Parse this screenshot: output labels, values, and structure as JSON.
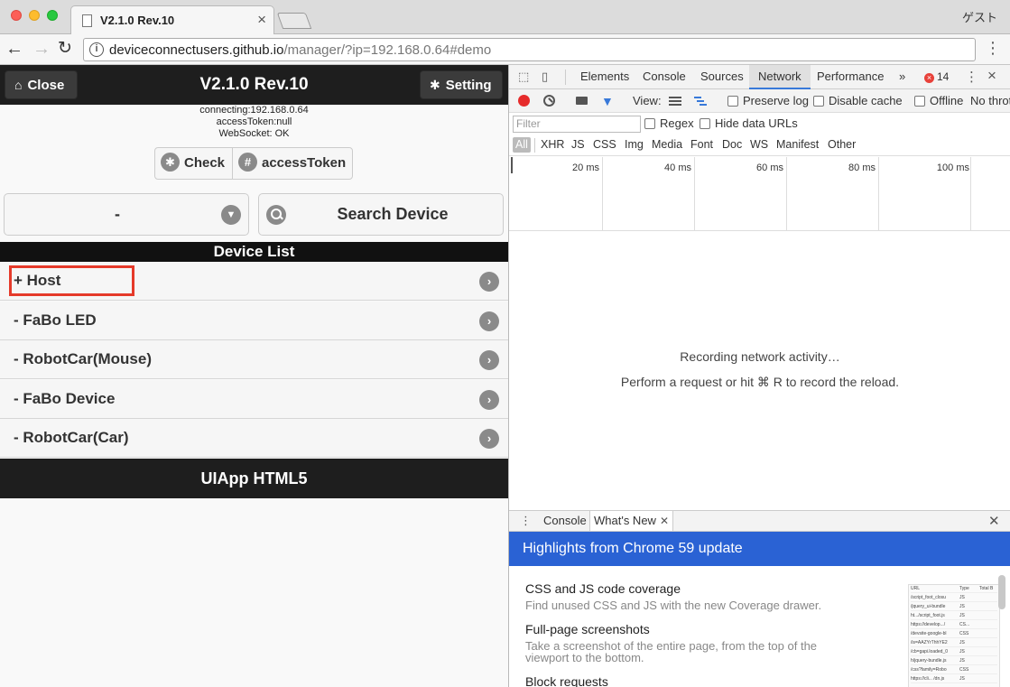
{
  "browser": {
    "tab_title": "V2.1.0 Rev.10",
    "tab_close": "×",
    "guest_label": "ゲスト",
    "url_host": "deviceconnectusers.github.io",
    "url_rest": "/manager/?ip=192.168.0.64#demo",
    "back": "←",
    "forward": "→",
    "reload": "↻",
    "info": "i",
    "menu": "⋮"
  },
  "app": {
    "close_label": "Close",
    "close_icon": "home-icon",
    "title": "V2.1.0 Rev.10",
    "setting_label": "Setting",
    "setting_icon": "gear-icon",
    "status_connecting": "connecting:192.168.0.64",
    "status_token": "accessToken:null",
    "status_ws": "WebSocket: OK",
    "check_label": "Check",
    "access_token_label": "accessToken",
    "select_value": "-",
    "search_label": "Search Device",
    "device_list_title": "Device List",
    "devices": [
      {
        "label": "+ Host"
      },
      {
        "label": "- FaBo LED"
      },
      {
        "label": "- RobotCar(Mouse)"
      },
      {
        "label": "- FaBo Device"
      },
      {
        "label": "- RobotCar(Car)"
      }
    ],
    "footer": "UIApp HTML5"
  },
  "devtools": {
    "tabs": [
      "Elements",
      "Console",
      "Sources",
      "Network",
      "Performance"
    ],
    "active_tab": "Network",
    "more": "»",
    "error_count": "14",
    "close": "×",
    "view_label": "View:",
    "preserve_log": "Preserve log",
    "disable_cache": "Disable cache",
    "offline": "Offline",
    "throttle": "No throt",
    "filter_placeholder": "Filter",
    "regex": "Regex",
    "hide_data_urls": "Hide data URLs",
    "types": [
      "All",
      "XHR",
      "JS",
      "CSS",
      "Img",
      "Media",
      "Font",
      "Doc",
      "WS",
      "Manifest",
      "Other"
    ],
    "timeline_ticks": [
      "20 ms",
      "40 ms",
      "60 ms",
      "80 ms",
      "100 ms"
    ],
    "empty_line1": "Recording network activity…",
    "empty_line2": "Perform a request or hit ⌘ R to record the reload.",
    "drawer_tabs": [
      "Console",
      "What's New"
    ],
    "banner": "Highlights from Chrome 59 update",
    "whats_new": [
      {
        "title": "CSS and JS code coverage",
        "desc": "Find unused CSS and JS with the new Coverage drawer."
      },
      {
        "title": "Full-page screenshots",
        "desc": "Take a screenshot of the entire page, from the top of the viewport to the bottom."
      },
      {
        "title": "Block requests",
        "desc": ""
      }
    ],
    "thumb_header": [
      "URL",
      "Type",
      "Total B"
    ],
    "thumb_rows": [
      [
        "/script_foot_closu",
        "JS"
      ],
      [
        "/jquery_ui-bundle",
        "JS"
      ],
      [
        "ht.../script_foot.js",
        "JS"
      ],
      [
        "https://develop.../",
        "CS..."
      ],
      [
        "/devsite-google-bl",
        "CSS"
      ],
      [
        "/is=AAZYrThhYE2",
        "JS"
      ],
      [
        "/cb=gapi.loaded_0",
        "JS"
      ],
      [
        "h/jquery-bundle.js",
        "JS"
      ],
      [
        "/css?family=Robo",
        "CSS"
      ],
      [
        "https://cli... /dn.js",
        "JS"
      ]
    ]
  }
}
